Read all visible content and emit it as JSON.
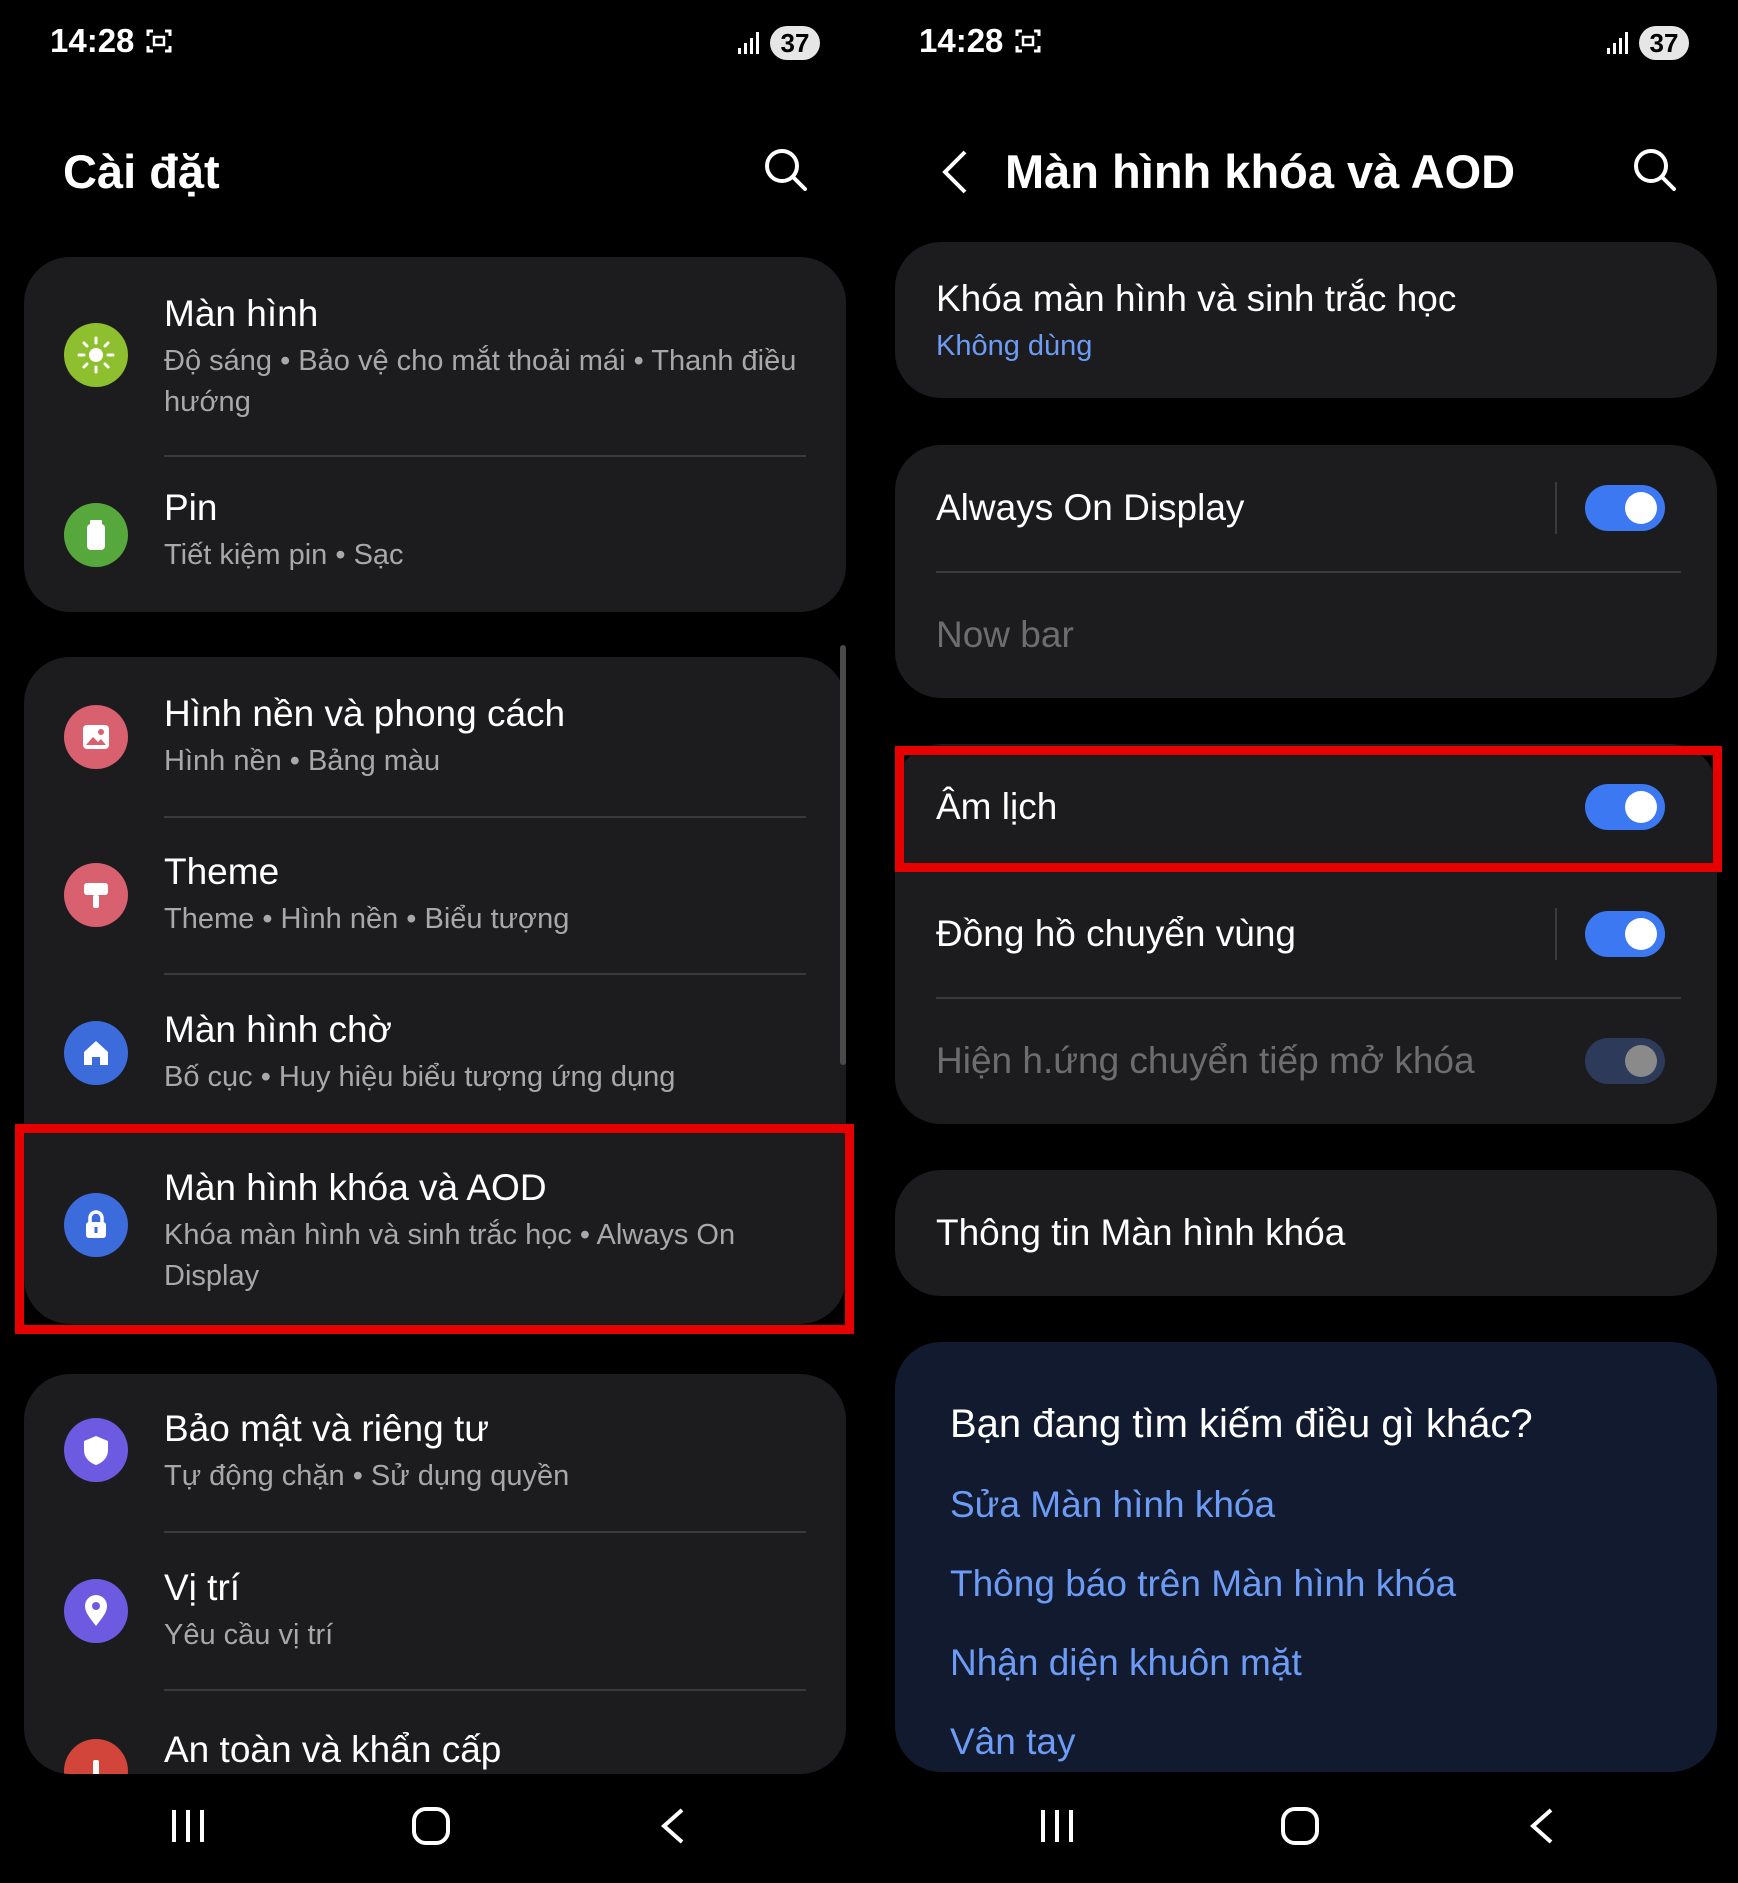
{
  "left": {
    "status": {
      "time": "14:28",
      "battery": "37"
    },
    "title": "Cài đặt",
    "card1": [
      {
        "title": "Màn hình",
        "subtitle": "Độ sáng  •  Bảo vệ cho mắt thoải mái  •  Thanh điều hướng",
        "icon": "sun-icon",
        "color": "#8dbf2e"
      },
      {
        "title": "Pin",
        "subtitle": "Tiết kiệm pin  •  Sạc",
        "icon": "battery-icon",
        "color": "#56a83c"
      }
    ],
    "card2": [
      {
        "title": "Hình nền và phong cách",
        "subtitle": "Hình nền  •  Bảng màu",
        "icon": "image-icon",
        "color": "#d9606e"
      },
      {
        "title": "Theme",
        "subtitle": "Theme  •  Hình nền  •  Biểu tượng",
        "icon": "paint-brush-icon",
        "color": "#d9606e"
      },
      {
        "title": "Màn hình chờ",
        "subtitle": "Bố cục  •  Huy hiệu biểu tượng ứng dụng",
        "icon": "home-icon",
        "color": "#3c6bdc"
      },
      {
        "title": "Màn hình khóa và AOD",
        "subtitle": "Khóa màn hình và sinh trắc học  •  Always On Display",
        "icon": "lock-icon",
        "color": "#3c6bdc"
      }
    ],
    "card3": [
      {
        "title": "Bảo mật và riêng tư",
        "subtitle": "Tự động chặn  •  Sử dụng quyền",
        "icon": "shield-icon",
        "color": "#6c5be0"
      },
      {
        "title": "Vị trí",
        "subtitle": "Yêu cầu vị trí",
        "icon": "location-pin-icon",
        "color": "#6c5be0"
      },
      {
        "title": "An toàn và khẩn cấp",
        "subtitle": "",
        "icon": "emergency-icon",
        "color": "#d2453a"
      }
    ]
  },
  "right": {
    "status": {
      "time": "14:28",
      "battery": "37"
    },
    "title": "Màn hình khóa và AOD",
    "lock_item": {
      "title": "Khóa màn hình và sinh trắc học",
      "subtitle": "Không dùng",
      "subtitle_color": "#6d9cf6"
    },
    "aod": {
      "title": "Always On Display",
      "state": "on"
    },
    "nowbar": {
      "title": "Now bar"
    },
    "lunar": {
      "title": "Âm lịch",
      "state": "on"
    },
    "roaming_clock": {
      "title": "Đồng hồ chuyển vùng",
      "state": "on"
    },
    "unlock_transition": {
      "title": "Hiện h.ứng chuyển tiếp mở khóa",
      "state": "off-disabled"
    },
    "info": {
      "title": "Thông tin Màn hình khóa"
    },
    "suggest": {
      "title": "Bạn đang tìm kiếm điều gì khác?",
      "links": [
        "Sửa Màn hình khóa",
        "Thông báo trên Màn hình khóa",
        "Nhận diện khuôn mặt",
        "Vân tay"
      ]
    }
  },
  "colors": {
    "accent": "#3b78f2",
    "highlight": "#e60000",
    "card": "#1c1c1e",
    "suggest_bg": "#111a2e"
  }
}
